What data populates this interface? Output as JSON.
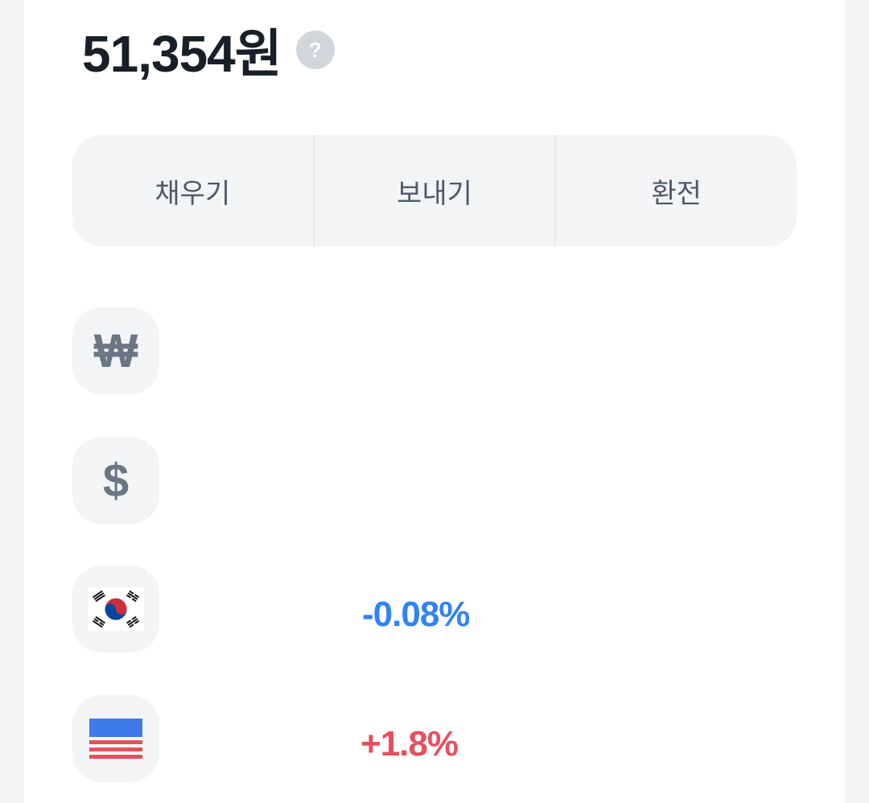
{
  "balance": {
    "amount": "51,354원",
    "help_icon": "?"
  },
  "actions": [
    {
      "label": "채우기"
    },
    {
      "label": "보내기"
    },
    {
      "label": "환전"
    }
  ],
  "assets": [
    {
      "icon": "won-icon",
      "glyph": "₩",
      "change": ""
    },
    {
      "icon": "dollar-icon",
      "glyph": "$",
      "change": ""
    },
    {
      "icon": "korea-flag-icon",
      "glyph": "",
      "change": "-0.08%"
    },
    {
      "icon": "us-flag-icon",
      "glyph": "",
      "change": "+1.8%"
    }
  ],
  "colors": {
    "negative": "#3182f6",
    "positive": "#e5505f",
    "primary_text": "#191f28",
    "secondary_text": "#4e5968"
  }
}
